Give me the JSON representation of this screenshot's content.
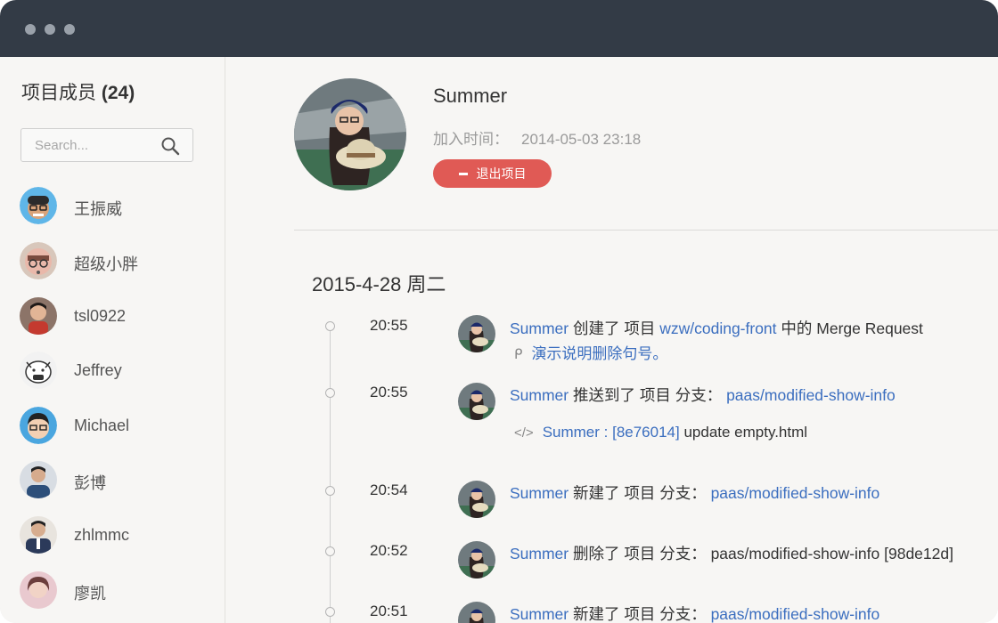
{
  "sidebar": {
    "title": "项目成员",
    "count": "(24)",
    "search_placeholder": "Search...",
    "members": [
      {
        "name": "王振威"
      },
      {
        "name": "超级小胖"
      },
      {
        "name": "tsl0922"
      },
      {
        "name": "Jeffrey"
      },
      {
        "name": "Michael"
      },
      {
        "name": "彭博"
      },
      {
        "name": "zhlmmc"
      },
      {
        "name": "廖凯"
      }
    ]
  },
  "profile": {
    "name": "Summer",
    "join_label": "加入时间：",
    "join_time": "2014-05-03 23:18",
    "quit_label": "退出项目"
  },
  "timeline": {
    "date": "2015-4-28 周二",
    "events": [
      {
        "time": "20:55",
        "user": "Summer",
        "action": " 创建了 项目 ",
        "target": "wzw/coding-front",
        "suffix": " 中的 Merge Request",
        "sub_link": "演示说明删除句号。"
      },
      {
        "time": "20:55",
        "user": "Summer",
        "action": " 推送到了 项目 分支： ",
        "target": "paas/modified-show-info",
        "commit_user": "Summer",
        "commit_sep": " : ",
        "commit_hash": "[8e76014]",
        "commit_msg": " update empty.html"
      },
      {
        "time": "20:54",
        "user": "Summer",
        "action": " 新建了 项目 分支： ",
        "target": "paas/modified-show-info"
      },
      {
        "time": "20:52",
        "user": "Summer",
        "action": " 删除了 项目 分支： ",
        "plain_target": "paas/modified-show-info [98de12d]"
      },
      {
        "time": "20:51",
        "user": "Summer",
        "action": " 新建了 项目 分支： ",
        "target": "paas/modified-show-info"
      }
    ]
  },
  "colors": {
    "titlebar": "#333b46",
    "link": "#3b6ebf",
    "danger": "#e05a55",
    "background": "#f7f6f4"
  }
}
